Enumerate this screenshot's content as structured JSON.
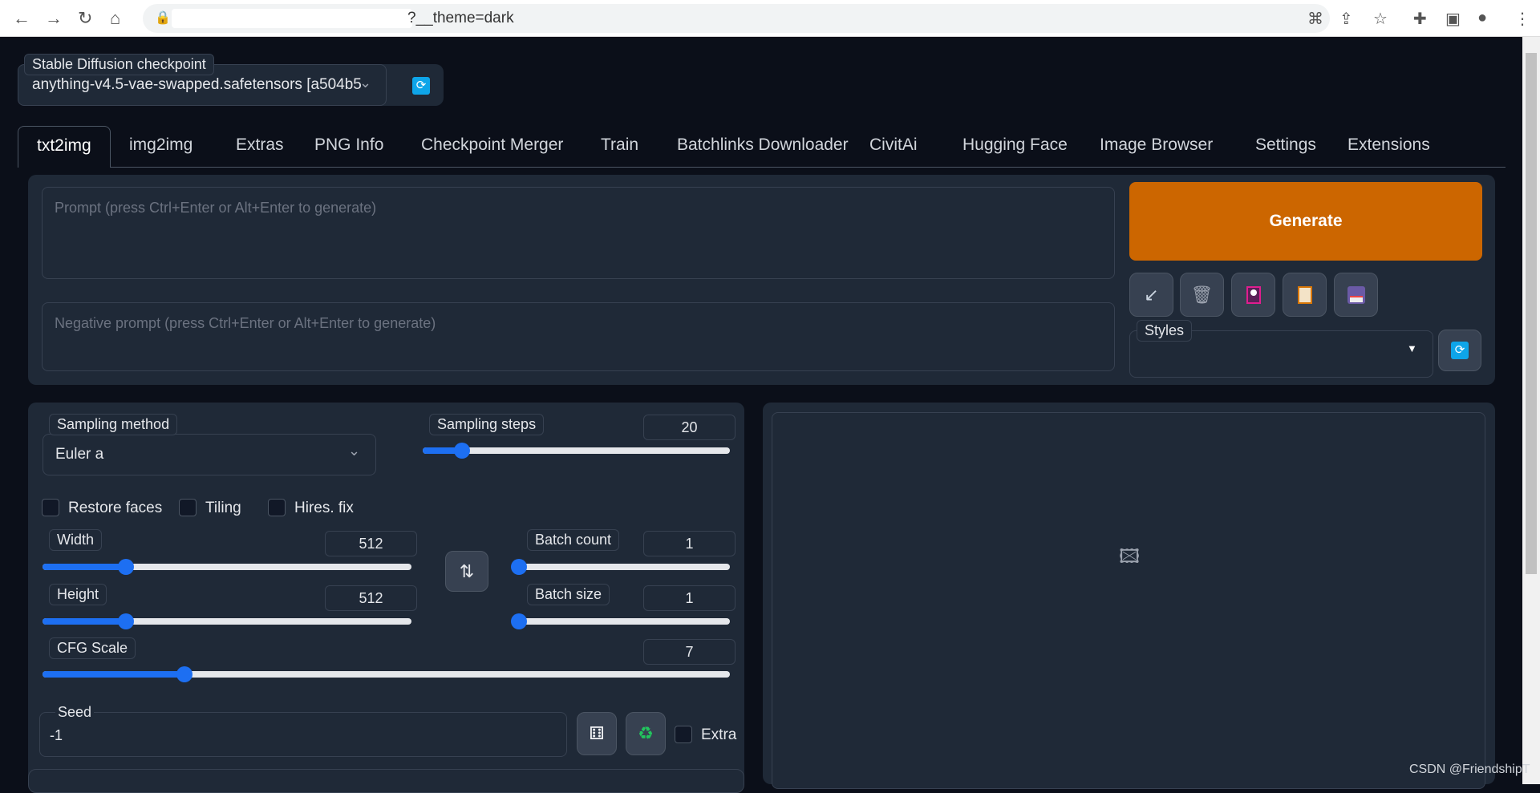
{
  "browser": {
    "url_visible": "?__theme=dark"
  },
  "checkpoint": {
    "label": "Stable Diffusion checkpoint",
    "value": "anything-v4.5-vae-swapped.safetensors [a504b5"
  },
  "tabs": [
    {
      "label": "txt2img",
      "active": true
    },
    {
      "label": "img2img"
    },
    {
      "label": "Extras"
    },
    {
      "label": "PNG Info"
    },
    {
      "label": "Checkpoint Merger"
    },
    {
      "label": "Train"
    },
    {
      "label": "Batchlinks Downloader"
    },
    {
      "label": "CivitAi"
    },
    {
      "label": "Hugging Face"
    },
    {
      "label": "Image Browser"
    },
    {
      "label": "Settings"
    },
    {
      "label": "Extensions"
    }
  ],
  "prompt": {
    "placeholder": "Prompt (press Ctrl+Enter or Alt+Enter to generate)",
    "value": ""
  },
  "negative_prompt": {
    "placeholder": "Negative prompt (press Ctrl+Enter or Alt+Enter to generate)",
    "value": ""
  },
  "generate": {
    "label": "Generate",
    "color": "#cc6600"
  },
  "styles": {
    "label": "Styles",
    "value": ""
  },
  "sampling": {
    "method_label": "Sampling method",
    "method_value": "Euler a",
    "steps_label": "Sampling steps",
    "steps": 20,
    "steps_min": 1,
    "steps_max": 150
  },
  "checkboxes": {
    "restore_faces": "Restore faces",
    "tiling": "Tiling",
    "hires_fix": "Hires. fix"
  },
  "width": {
    "label": "Width",
    "value": 512,
    "min": 64,
    "max": 2048
  },
  "height": {
    "label": "Height",
    "value": 512,
    "min": 64,
    "max": 2048
  },
  "batch_count": {
    "label": "Batch count",
    "value": 1,
    "min": 1,
    "max": 100
  },
  "batch_size": {
    "label": "Batch size",
    "value": 1,
    "min": 1,
    "max": 8
  },
  "cfg": {
    "label": "CFG Scale",
    "value": 7,
    "min": 1,
    "max": 30
  },
  "seed": {
    "label": "Seed",
    "value": "-1",
    "extra_label": "Extra"
  },
  "watermark": "CSDN @FriendshipT",
  "accent": "#1d6ff2"
}
